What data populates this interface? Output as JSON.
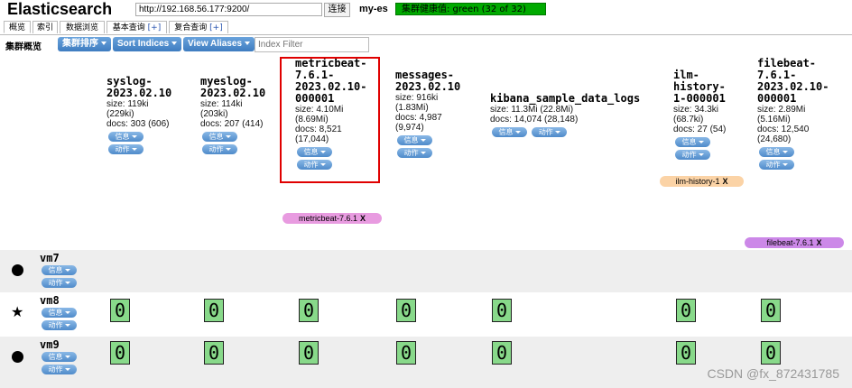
{
  "header": {
    "brand": "Elasticsearch",
    "url": "http://192.168.56.177:9200/",
    "connect_label": "连接",
    "cluster_name": "my-es",
    "health_text": "集群健康值: green (32 of 32)",
    "health_color": "#00aa00"
  },
  "tabs": [
    {
      "label": "概览",
      "plus": ""
    },
    {
      "label": "索引",
      "plus": ""
    },
    {
      "label": "数据浏览",
      "plus": ""
    },
    {
      "label": "基本查询",
      "plus": "[+]"
    },
    {
      "label": "复合查询",
      "plus": "[+]"
    }
  ],
  "toolbar": {
    "label": "集群概览",
    "sort_cluster": "集群排序",
    "sort_indices": "Sort Indices",
    "view_aliases": "View Aliases",
    "filter_placeholder": "Index Filter"
  },
  "pills": {
    "info": "信息",
    "action": "动作"
  },
  "indices": [
    {
      "name": "syslog-\n2023.02.10",
      "size": "size: 119ki",
      "size2": "(229ki)",
      "docs": "docs: 303 (606)",
      "docs2": ""
    },
    {
      "name": "myeslog-\n2023.02.10",
      "size": "size: 114ki",
      "size2": "(203ki)",
      "docs": "docs: 207 (414)",
      "docs2": ""
    },
    {
      "name": "metricbeat-\n7.6.1-\n2023.02.10-\n000001",
      "size": "size: 4.10Mi",
      "size2": "(8.69Mi)",
      "docs": "docs: 8,521",
      "docs2": "(17,044)"
    },
    {
      "name": "messages-\n2023.02.10",
      "size": "size: 916ki",
      "size2": "(1.83Mi)",
      "docs": "docs: 4,987",
      "docs2": "(9,974)"
    },
    {
      "name": "kibana_sample_data_logs",
      "size": "size: 11.3Mi (22.8Mi)",
      "size2": "",
      "docs": "docs: 14,074 (28,148)",
      "docs2": ""
    },
    {
      "name": "ilm-\nhistory-\n1-000001",
      "size": "size: 34.3ki",
      "size2": "(68.7ki)",
      "docs": "docs: 27 (54)",
      "docs2": ""
    },
    {
      "name": "filebeat-\n7.6.1-\n2023.02.10-\n000001",
      "size": "size: 2.89Mi",
      "size2": "(5.16Mi)",
      "docs": "docs: 12,540",
      "docs2": "(24,680)"
    }
  ],
  "aliases": [
    {
      "label": "ilm-history-1",
      "x": "X",
      "color": "#fbd3a6"
    },
    {
      "label": "metricbeat-7.6.1",
      "x": "X",
      "color": "#e89be0"
    },
    {
      "label": "filebeat-7.6.1",
      "x": "X",
      "color": "#cc88e8"
    }
  ],
  "nodes": [
    {
      "name": "vm7",
      "icon": "dot-icon"
    },
    {
      "name": "vm8",
      "icon": "star-icon"
    },
    {
      "name": "vm9",
      "icon": "dot-icon"
    }
  ],
  "shard_label": "0",
  "watermark": "CSDN @fx_872431785"
}
